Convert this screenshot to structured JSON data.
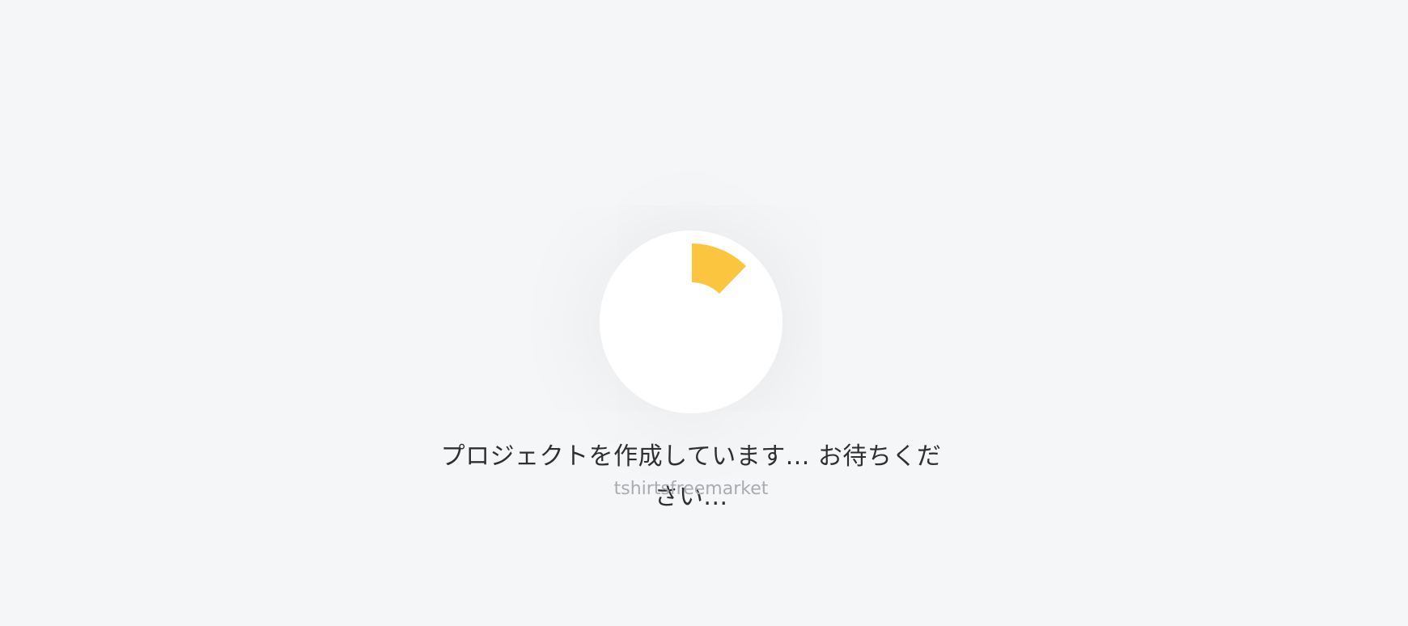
{
  "loading": {
    "message": "プロジェクトを作成しています... お待ちください...",
    "project_name": "tshirtsfreemarket",
    "spinner_icon": "loading-spinner-icon",
    "spinner_color": "#fcc53f"
  }
}
